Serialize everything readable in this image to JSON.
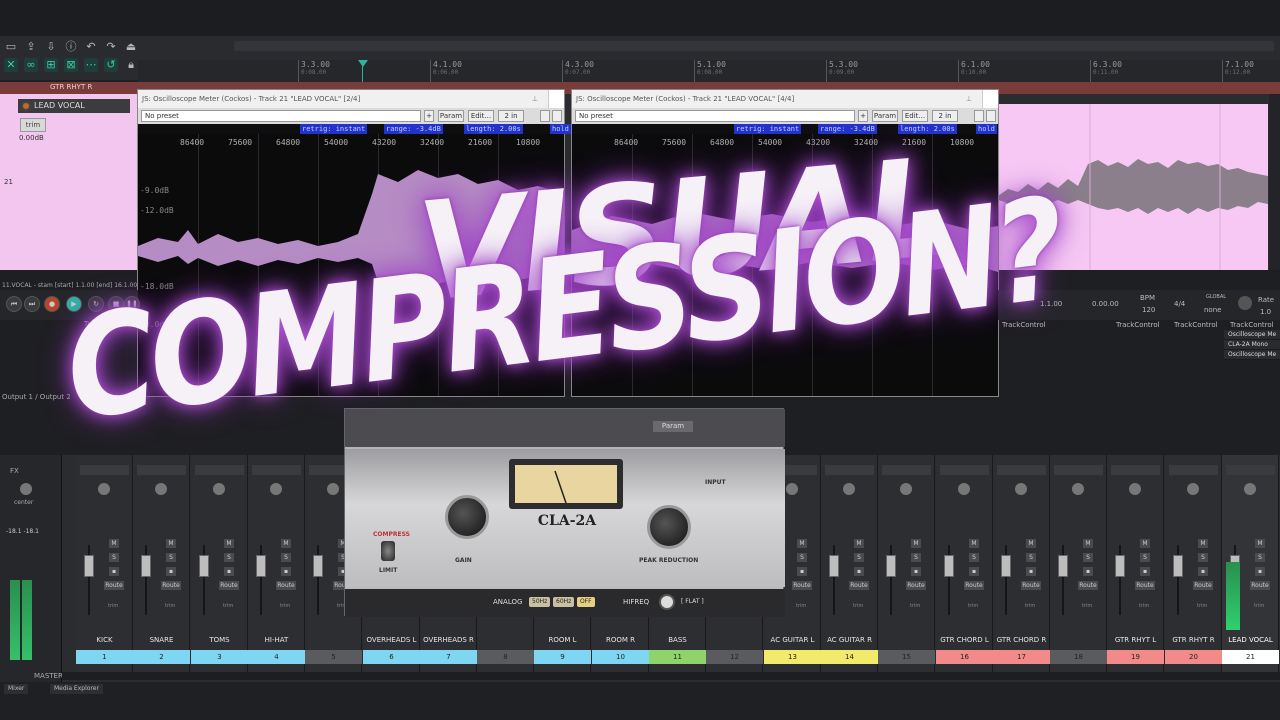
{
  "ruler": {
    "marks": [
      {
        "label": "3.3.00",
        "sub": "0:08.00"
      },
      {
        "label": "4.1.00",
        "sub": "0:06.00"
      },
      {
        "label": "4.3.00",
        "sub": "0:07.00"
      },
      {
        "label": "5.1.00",
        "sub": "0:08.00"
      },
      {
        "label": "5.3.00",
        "sub": "0:09.00"
      },
      {
        "label": "6.1.00",
        "sub": "0:10.00"
      },
      {
        "label": "6.3.00",
        "sub": "0:11.00"
      },
      {
        "label": "7.1.00",
        "sub": "0:12.00"
      }
    ]
  },
  "arrange": {
    "top_track_name": "GTR RHYT R",
    "track_name": "LEAD VOCAL",
    "trim_label": "trim",
    "volume": "0.00dB",
    "track_number": "21"
  },
  "jswin_left": {
    "title": "JS: Oscilloscope Meter (Cockos) - Track 21 \"LEAD VOCAL\" [2/4]",
    "preset": "No preset",
    "plus": "+",
    "param": "Param",
    "edit": "Edit...",
    "io": "2 in",
    "info": [
      "retrig: instant",
      "range: -3.4dB",
      "length: 2.00s",
      "hold"
    ],
    "freqs": [
      "86400",
      "75600",
      "64800",
      "54000",
      "43200",
      "32400",
      "21600",
      "10800"
    ],
    "db": [
      "-9.0dB",
      "-12.0dB",
      "-18.0dB",
      "-9.0dB"
    ]
  },
  "jswin_right": {
    "title": "JS: Oscilloscope Meter (Cockos) - Track 21 \"LEAD VOCAL\" [4/4]",
    "preset": "No preset",
    "plus": "+",
    "param": "Param",
    "edit": "Edit...",
    "io": "2 in",
    "info": [
      "retrig: instant",
      "range: -3.4dB",
      "length: 2.00s",
      "hold"
    ],
    "freqs": [
      "86400",
      "75600",
      "64800",
      "54000",
      "43200",
      "32400",
      "21600",
      "10800"
    ]
  },
  "transport": {
    "status": "11.VOCAL - stam [start] 1.1.00 [end] 16.1.00",
    "trackcontrol": "TrackControl",
    "position": "1.1.00",
    "time": "0.00.00",
    "bpm_label": "BPM",
    "bpm": "120",
    "sig": "4/4",
    "global": "GLOBAL",
    "none": "none",
    "rate_label": "Rate",
    "rate": "1.0",
    "output": "Output 1 / Output 2"
  },
  "fx_list": [
    "Oscilloscope Me",
    "CLA-2A Mono",
    "Oscilloscope Me"
  ],
  "mixer": {
    "master_label": "MASTER",
    "master_db": [
      "-18.1",
      "-18.1"
    ],
    "fx_label": "FX",
    "center_label": "center",
    "route_label": "Route",
    "trim_label": "trim",
    "strips": [
      {
        "name": "KICK",
        "num": "1",
        "color": "#7fd6f2"
      },
      {
        "name": "SNARE",
        "num": "2",
        "color": "#7fd6f2"
      },
      {
        "name": "TOMS",
        "num": "3",
        "color": "#7fd6f2"
      },
      {
        "name": "HI-HAT",
        "num": "4",
        "color": "#7fd6f2"
      },
      {
        "name": "",
        "num": "5",
        "color": "#5a5b5f"
      },
      {
        "name": "OVERHEADS L",
        "num": "6",
        "color": "#7fd6f2"
      },
      {
        "name": "OVERHEADS R",
        "num": "7",
        "color": "#7fd6f2"
      },
      {
        "name": "",
        "num": "8",
        "color": "#5a5b5f"
      },
      {
        "name": "ROOM L",
        "num": "9",
        "color": "#7fd6f2"
      },
      {
        "name": "ROOM R",
        "num": "10",
        "color": "#7fd6f2"
      },
      {
        "name": "BASS",
        "num": "11",
        "color": "#8fd46a"
      },
      {
        "name": "",
        "num": "12",
        "color": "#5a5b5f"
      },
      {
        "name": "AC GUITAR L",
        "num": "13",
        "color": "#f2ea6a"
      },
      {
        "name": "AC GUITAR R",
        "num": "14",
        "color": "#f2ea6a"
      },
      {
        "name": "",
        "num": "15",
        "color": "#5a5b5f"
      },
      {
        "name": "GTR CHORD L",
        "num": "16",
        "color": "#f28a8a"
      },
      {
        "name": "GTR CHORD R",
        "num": "17",
        "color": "#f28a8a"
      },
      {
        "name": "",
        "num": "18",
        "color": "#5a5b5f"
      },
      {
        "name": "GTR RHYT L",
        "num": "19",
        "color": "#f28a8a"
      },
      {
        "name": "GTR RHYT R",
        "num": "20",
        "color": "#f28a8a"
      },
      {
        "name": "LEAD VOCAL",
        "num": "21",
        "color": "#ffffff"
      }
    ]
  },
  "cla2a": {
    "param": "Param",
    "name": "CLA-2A",
    "gain": "GAIN",
    "peak_reduction": "PEAK REDUCTION",
    "compress": "COMPRESS",
    "limit": "LIMIT",
    "input": "INPUT",
    "analog": "ANALOG",
    "analog_opts": [
      "50Hz",
      "60Hz",
      "OFF"
    ],
    "hifreq": "HIFREQ",
    "flat": "[ FLAT ]"
  },
  "tabs": [
    "Mixer",
    "Media Explorer"
  ],
  "headline": {
    "line1": "VISUAL",
    "line2": "COMPRESSION?"
  }
}
